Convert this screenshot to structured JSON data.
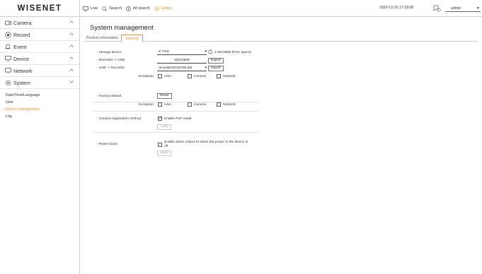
{
  "header": {
    "logo": "WISENET",
    "nav": [
      {
        "label": "Live",
        "icon": "monitor-icon",
        "active": false
      },
      {
        "label": "Search",
        "icon": "search-icon",
        "active": false
      },
      {
        "label": "AI search",
        "icon": "ai-search-icon",
        "active": false
      },
      {
        "label": "Setup",
        "icon": "gear-icon",
        "active": true
      }
    ],
    "datetime": "2020-12-16 17:18:08",
    "user": "admin",
    "help": "?"
  },
  "sidebar": {
    "items": [
      {
        "label": "Camera",
        "icon": "camera-icon",
        "expanded": false
      },
      {
        "label": "Record",
        "icon": "record-icon",
        "expanded": false
      },
      {
        "label": "Event",
        "icon": "bell-icon",
        "expanded": false
      },
      {
        "label": "Device",
        "icon": "device-icon",
        "expanded": false
      },
      {
        "label": "Network",
        "icon": "network-icon",
        "expanded": false
      },
      {
        "label": "System",
        "icon": "gear-icon",
        "expanded": true
      }
    ],
    "submenu": [
      {
        "label": "Date/Time/Language",
        "active": false
      },
      {
        "label": "User",
        "active": false
      },
      {
        "label": "System management",
        "active": true
      },
      {
        "label": "Log",
        "active": false
      }
    ]
  },
  "main": {
    "title": "System management",
    "tabs": [
      {
        "label": "Product information",
        "active": false
      },
      {
        "label": "Settings",
        "active": true
      }
    ],
    "storage": {
      "label": "Storage device",
      "device": "X TICK",
      "free_space": "1.067380B (Free space)",
      "recorder_to_usb_label": "Recorder -> USB",
      "export_filename": "20121600",
      "export_button": "Export",
      "usb_to_recorder_label": "USB -> Recorder",
      "import_file": "recorder20120700.dat",
      "import_button": "Import",
      "exception_label": "Exception",
      "exceptions": [
        {
          "label": "User",
          "checked": false
        },
        {
          "label": "Camera",
          "checked": false
        },
        {
          "label": "Network",
          "checked": false
        }
      ]
    },
    "factory": {
      "label": "Factory default",
      "reset_button": "Reset",
      "exception_label": "Exception",
      "exceptions": [
        {
          "label": "User",
          "checked": false
        },
        {
          "label": "Camera",
          "checked": false
        },
        {
          "label": "Network",
          "checked": false
        }
      ]
    },
    "camera_registration": {
      "label": "Camera registration method",
      "pnp_label": "Enable PnP mode",
      "pnp_checked": true,
      "apply_button": "Apply"
    },
    "power_down": {
      "label": "Power down",
      "alarm_label_line1": "Enable alarm output #1 when the power to the device is",
      "alarm_label_line2": "off",
      "alarm_checked": false,
      "apply_button": "Apply"
    }
  },
  "colors": {
    "accent": "#e8922d",
    "border": "#cfcfcf",
    "text": "#333333"
  }
}
